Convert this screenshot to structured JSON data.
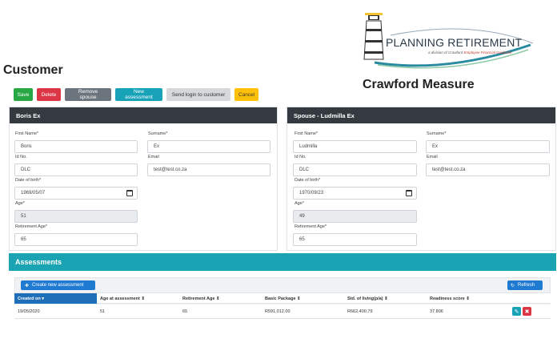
{
  "page": {
    "title": "Customer"
  },
  "logo": {
    "title": "PLANNING RETIREMENT",
    "subtitle_prefix": "a division of Crawford",
    "subtitle_brand": "Employee Financial Guidance"
  },
  "measure": {
    "title": "Crawford Measure"
  },
  "toolbar": {
    "save": "Save",
    "delete": "Delete",
    "remove_spouse": "Remove spouse",
    "new_assessment": "New assessment",
    "send_login": "Send login to customer",
    "cancel": "Cancel"
  },
  "customer": {
    "header": "Boris Ex",
    "first_name_label": "First Name*",
    "first_name": "Boris",
    "surname_label": "Surname*",
    "surname": "Ex",
    "id_label": "Id No.",
    "id_no": "DLC",
    "email_label": "Email",
    "email": "test@test.co.za",
    "dob_label": "Date of birth*",
    "dob": "1969/05/07",
    "age_label": "Age*",
    "age": "51",
    "retirement_label": "Retirement Age*",
    "retirement_age": "65"
  },
  "spouse": {
    "header": "Spouse -  Ludmilla Ex",
    "first_name_label": "First Name*",
    "first_name": "Ludmilla",
    "surname_label": "Surname*",
    "surname": "Ex",
    "id_label": "Id No.",
    "id_no": "DLC",
    "email_label": "Email",
    "email": "test@test.co.za",
    "dob_label": "Date of birth*",
    "dob": "1970/09/23",
    "age_label": "Age*",
    "age": "49",
    "retirement_label": "Retirement Age*",
    "retirement_age": "65"
  },
  "assessments": {
    "title": "Assessments",
    "create_label": "Create new assessment",
    "refresh_label": "Refresh",
    "columns": [
      "Created on ▾",
      "Age at assessment ⇕",
      "Retirement Age ⇕",
      "Basic Package ⇕",
      "Std. of living(p/a) ⇕",
      "Readiness score ⇕"
    ],
    "rows": [
      [
        "19/05/2020",
        "51",
        "65",
        "R591,012.00",
        "R662,400.79",
        "37.806"
      ]
    ]
  },
  "colors": {
    "save": "#28a745",
    "delete": "#dc3545",
    "info": "#17a2b8",
    "warning": "#ffc107",
    "header_dark": "#343a40",
    "primary": "#1f7ad1"
  }
}
